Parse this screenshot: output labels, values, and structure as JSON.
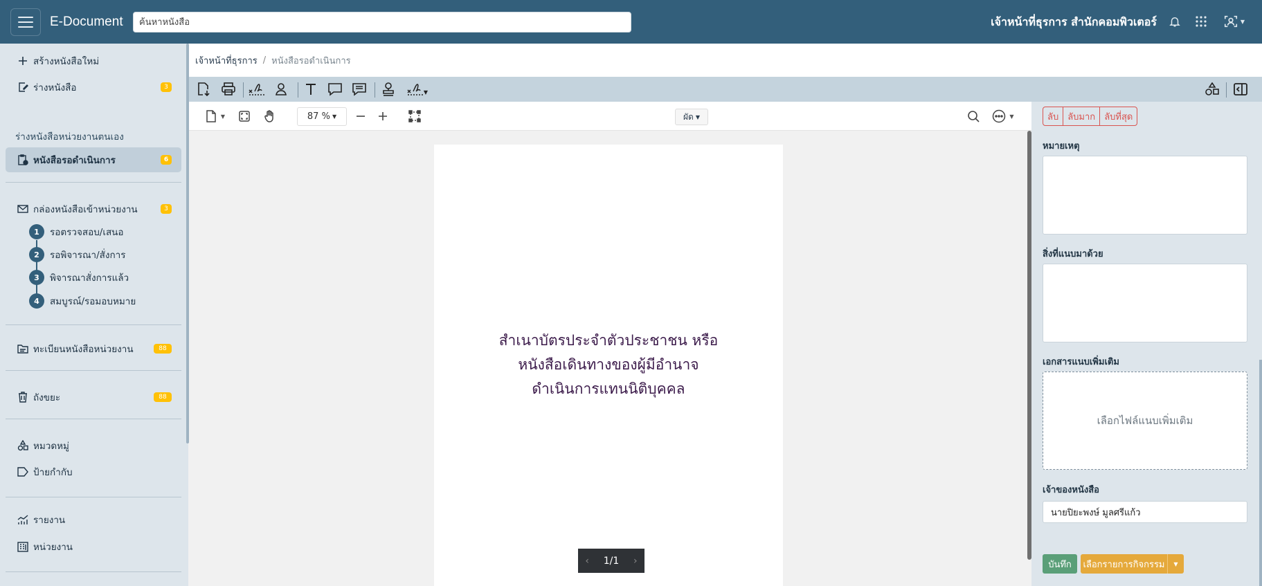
{
  "app": {
    "title": "E-Document",
    "search_placeholder": "ค้นหาหนังสือ",
    "user": "เจ้าหน้าที่ธุรการ สำนักคอมพิวเตอร์"
  },
  "sidebar": {
    "create": "สร้างหนังสือใหม่",
    "draft": "ร่างหนังสือ",
    "draft_badge": "3",
    "section_heading": "ร่างหนังสือหน่วยงานตนเอง",
    "pending": "หนังสือรอดำเนินการ",
    "pending_badge": "6",
    "inbox": "กล่องหนังสือเข้าหน่วยงาน",
    "inbox_badge": "3",
    "steps": [
      {
        "num": "1",
        "label": "รอตรวจสอบ/เสนอ"
      },
      {
        "num": "2",
        "label": "รอพิจารณา/สั่งการ"
      },
      {
        "num": "3",
        "label": "พิจารณาสั่งการแล้ว"
      },
      {
        "num": "4",
        "label": "สมบูรณ์/รอมอบหมาย"
      }
    ],
    "registry": "ทะเบียนหนังสือหน่วยงาน",
    "registry_badge": "88",
    "trash": "ถังขยะ",
    "trash_badge": "88",
    "category": "หมวดหมู่",
    "tag": "ป้ายกำกับ",
    "report": "รายงาน",
    "unit": "หน่วยงาน"
  },
  "breadcrumb": {
    "root": "เจ้าหน้าที่ธุรการ",
    "sep": "/",
    "current": "หนังสือรอดำเนินการ"
  },
  "viewer": {
    "zoom": "87 %",
    "mode": "ผัด",
    "page_lines": [
      "สำเนาบัตรประจำตัวประชาชน หรือ",
      "หนังสือเดินทางของผู้มีอำนาจ",
      "ดำเนินการแทนนิติบุคคล"
    ],
    "pager": "1/1"
  },
  "panel": {
    "secret": [
      "ลับ",
      "ลับมาก",
      "ลับที่สุด"
    ],
    "note_label": "หมายเหตุ",
    "attach_label": "สิ่งที่แนบมาด้วย",
    "extra_label": "เอกสารแนบเพิ่มเติม",
    "drop_text": "เลือกไฟล์แนบเพิ่มเติม",
    "owner_label": "เจ้าของหนังสือ",
    "owner_value": "นายปิยะพงษ์ มูลศรีแก้ว",
    "save": "บันทึก",
    "activity": "เลือกรายการกิจกรรม"
  },
  "colors": {
    "topbar": "#335f7b",
    "sidebar": "#dde5eb",
    "badge": "#ffc107",
    "danger": "#d9534f",
    "success": "#5a9f78",
    "warning": "#e5a93b"
  },
  "icons": {
    "top": [
      "bell-icon",
      "apps-grid-icon",
      "user-scan-icon"
    ],
    "toolbar": [
      "export-doc-icon",
      "print-icon",
      "signature-icon",
      "stamp-person-icon",
      "text-icon",
      "comment-icon",
      "comment-lines-icon",
      "stamp-icon",
      "signature-dropdown-icon",
      "shapes-icon",
      "sidebar-toggle-icon"
    ]
  }
}
